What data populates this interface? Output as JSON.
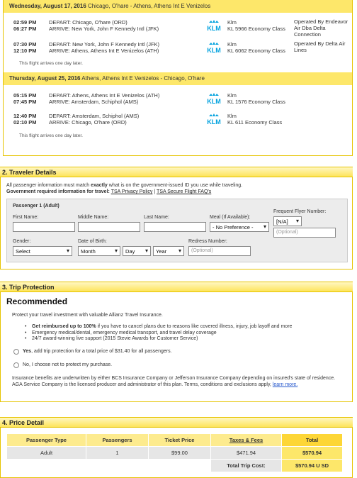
{
  "flights": {
    "outbound": {
      "heading_date": "Wednesday, August 17, 2016",
      "heading_route": "Chicago, O'hare - Athens, Athens Int E Venizelos",
      "segments": [
        {
          "dep_time": "02:59 PM",
          "dep_text": "DEPART: Chicago, O'hare (ORD)",
          "arr_time": "06:27 PM",
          "arr_text": "ARRIVE: New York, John F Kennedy Intl (JFK)",
          "airline": "Klm",
          "flight_class": "KL 5966 Economy Class",
          "operated_by": "Operated By Endeavor Air Dba Delta Connection"
        },
        {
          "dep_time": "07:30 PM",
          "dep_text": "DEPART: New York, John F Kennedy Intl (JFK)",
          "arr_time": "12:10 PM",
          "arr_text": "ARRIVE: Athens, Athens Int E Venizelos (ATH)",
          "airline": "Klm",
          "flight_class": "KL 6062 Economy Class",
          "operated_by": "Operated By Delta Air Lines"
        }
      ],
      "note": "This flight arrives one day later."
    },
    "return": {
      "heading_date": "Thursday, August 25, 2016",
      "heading_route": "Athens, Athens Int E Venizelos - Chicago, O'hare",
      "segments": [
        {
          "dep_time": "05:15 PM",
          "dep_text": "DEPART: Athens, Athens Int E Venizelos (ATH)",
          "arr_time": "07:45 PM",
          "arr_text": "ARRIVE: Amsterdam, Schiphol (AMS)",
          "airline": "Klm",
          "flight_class": "KL 1576 Economy Class",
          "operated_by": ""
        },
        {
          "dep_time": "12:40 PM",
          "dep_text": "DEPART: Amsterdam, Schiphol (AMS)",
          "arr_time": "02:10 PM",
          "arr_text": "ARRIVE: Chicago, O'hare (ORD)",
          "airline": "Klm",
          "flight_class": "KL 611 Economy Class",
          "operated_by": ""
        }
      ],
      "note": "This flight arrives one day later."
    },
    "logo_text": "KLM"
  },
  "traveler": {
    "section_title": "2. Traveler Details",
    "intro_pre": "All passenger information must match ",
    "intro_bold": "exactly",
    "intro_post": " what is on the government-issued ID you use while traveling.",
    "gov_label": "Government required information for travel:",
    "tsa_privacy": "TSA Privacy Policy",
    "separator": "|",
    "tsa_faq": "TSA Secure Flight FAQ's",
    "passenger_title": "Passenger 1 (Adult)",
    "first_name_label": "First Name:",
    "middle_name_label": "Middle Name:",
    "last_name_label": "Last Name:",
    "meal_label": "Meal (If Available):",
    "meal_value": "- No Preference -",
    "ffn_label": "Frequent Flyer Number:",
    "ffn_airline_value": "[N/A]",
    "ffn_placeholder": "(Optional)",
    "gender_label": "Gender:",
    "gender_value": "Select",
    "dob_label": "Date of Birth:",
    "dob_month": "Month",
    "dob_day": "Day",
    "dob_year": "Year",
    "redress_label": "Redress Number:",
    "redress_placeholder": "(Optional)"
  },
  "protection": {
    "section_title": "3. Trip Protection",
    "heading": "Recommended",
    "intro": "Protect your travel investment with valuable Allianz Travel Insurance.",
    "bullet1_bold": "Get reimbursed up to 100%",
    "bullet1_rest": " if you have to cancel plans due to reasons like covered illness, injury, job layoff and more",
    "bullet2": "Emergency medical/dental, emergency medical transport, and travel delay coverage",
    "bullet3": "24/7 award-winning live support (2015 Stevie Awards for Customer Service)",
    "yes_bold": "Yes",
    "yes_rest": ", add trip protection for a total price of $31.40 for all passengers.",
    "no_text": "No, I choose not to protect my purchase.",
    "disclaimer": "Insurance benefits are underwritten by either BCS Insurance Company or Jefferson Insurance Company depending on insured's state of residence. AGA Service Company is the licensed producer and administrator of this plan. Terms, conditions and exclusions apply,",
    "learn_more": "learn more."
  },
  "price": {
    "section_title": "4. Price Detail",
    "headers": [
      "Passenger Type",
      "Passengers",
      "Ticket Price",
      "Taxes & Fees",
      "Total"
    ],
    "row": {
      "type": "Adult",
      "count": "1",
      "ticket": "$99.00",
      "taxes": "$471.94",
      "total": "$570.94"
    },
    "total_label": "Total Trip Cost:",
    "total_value": "$570.94 U SD"
  },
  "colors": {
    "accent_yellow": "#fde76a",
    "border_yellow": "#e6c400",
    "klm_blue": "#00a1de"
  }
}
